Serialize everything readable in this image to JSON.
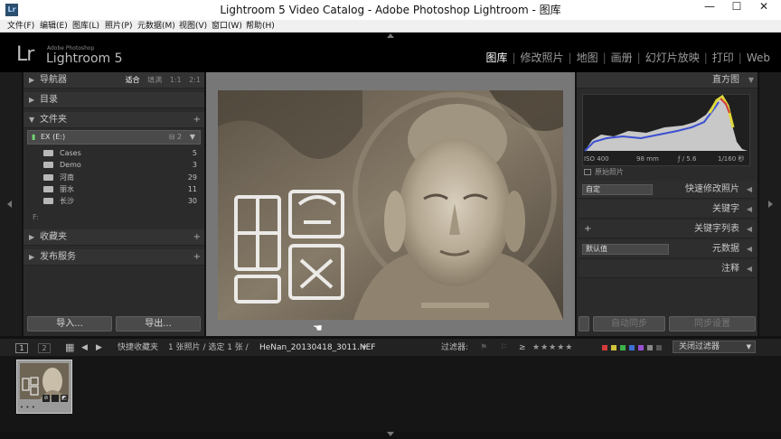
{
  "window": {
    "title": "Lightroom 5 Video Catalog - Adobe Photoshop Lightroom - 图库",
    "app_icon": "Lr",
    "minimize": "—",
    "maximize": "☐",
    "close": "✕"
  },
  "menu": [
    "文件(F)",
    "编辑(E)",
    "图库(L)",
    "照片(P)",
    "元数据(M)",
    "视图(V)",
    "窗口(W)",
    "帮助(H)"
  ],
  "brand": {
    "mark": "Lr",
    "adobe": "Adobe Photoshop",
    "name": "Lightroom 5"
  },
  "modules": [
    {
      "label": "图库",
      "active": true
    },
    {
      "label": "修改照片",
      "active": false
    },
    {
      "label": "地图",
      "active": false
    },
    {
      "label": "画册",
      "active": false
    },
    {
      "label": "幻灯片放映",
      "active": false
    },
    {
      "label": "打印",
      "active": false
    },
    {
      "label": "Web",
      "active": false
    }
  ],
  "left_panel": {
    "navigator": {
      "label": "导航器",
      "zoom": [
        "适合",
        "填满",
        "1:1",
        "2:1"
      ],
      "zoom_selected": "适合"
    },
    "catalog": {
      "label": "目录"
    },
    "folders": {
      "label": "文件夹",
      "volume": "EX (E:)",
      "volume_meta": "⊟ 2",
      "items": [
        {
          "name": "Cases",
          "count": "5"
        },
        {
          "name": "Demo",
          "count": "3"
        },
        {
          "name": "河南",
          "count": "29"
        },
        {
          "name": "丽水",
          "count": "11"
        },
        {
          "name": "长沙",
          "count": "30"
        }
      ],
      "extra": "F:"
    },
    "collections": {
      "label": "收藏夹"
    },
    "publish": {
      "label": "发布服务"
    },
    "import_btn": "导入...",
    "export_btn": "导出..."
  },
  "right_panel": {
    "histogram": {
      "label": "直方图",
      "iso": "ISO 400",
      "focal": "98 mm",
      "aperture": "ƒ / 5.6",
      "shutter": "1/160 秒",
      "original": "原始照片"
    },
    "quick_develop": {
      "label": "快速修改照片",
      "preset": "自定"
    },
    "keywords": {
      "label": "关键字"
    },
    "keyword_list": {
      "label": "关键字列表"
    },
    "metadata": {
      "label": "元数据",
      "preset": "默认值"
    },
    "comments": {
      "label": "注释"
    },
    "sync_btn": "自动同步",
    "sync_settings_btn": "同步设置"
  },
  "toolbar": {
    "pages": [
      "1",
      "2"
    ],
    "quick_collection": "快捷收藏夹",
    "info": "1 张照片 / 选定 1 张 /",
    "filename": "HeNan_20130418_3011.NEF",
    "filter_label": "过滤器:",
    "filter_value": "关闭过滤器",
    "stars": "★★★★★"
  },
  "colors": {
    "red": "#d23b3b",
    "yellow": "#d2c43b",
    "green": "#3bb34a",
    "blue": "#3b6fd2",
    "purple": "#9a4fd2",
    "gray": "#888888"
  }
}
